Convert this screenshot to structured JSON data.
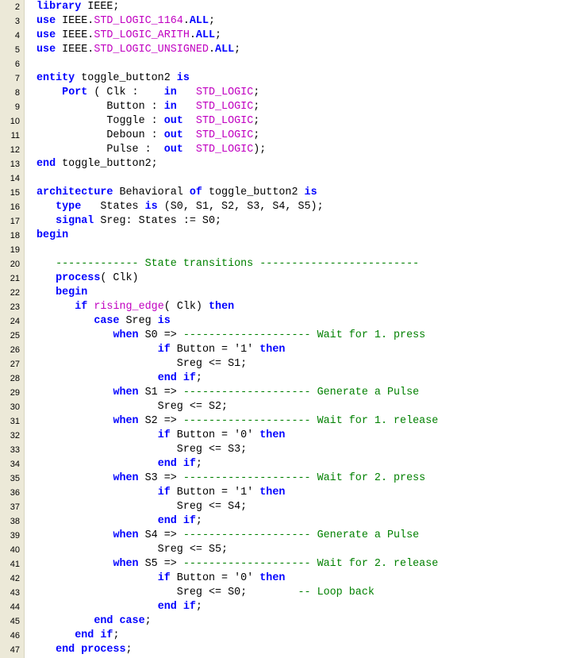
{
  "editor": {
    "lines": [
      {
        "n": "2",
        "t": [
          [
            "kw",
            "library"
          ],
          [
            "pl",
            " IEEE;"
          ]
        ]
      },
      {
        "n": "3",
        "t": [
          [
            "kw",
            "use"
          ],
          [
            "pl",
            " IEEE."
          ],
          [
            "ty",
            "STD_LOGIC_1164"
          ],
          [
            "pl",
            "."
          ],
          [
            "kw",
            "ALL"
          ],
          [
            "pl",
            ";"
          ]
        ]
      },
      {
        "n": "4",
        "t": [
          [
            "kw",
            "use"
          ],
          [
            "pl",
            " IEEE."
          ],
          [
            "ty",
            "STD_LOGIC_ARITH"
          ],
          [
            "pl",
            "."
          ],
          [
            "kw",
            "ALL"
          ],
          [
            "pl",
            ";"
          ]
        ]
      },
      {
        "n": "5",
        "t": [
          [
            "kw",
            "use"
          ],
          [
            "pl",
            " IEEE."
          ],
          [
            "ty",
            "STD_LOGIC_UNSIGNED"
          ],
          [
            "pl",
            "."
          ],
          [
            "kw",
            "ALL"
          ],
          [
            "pl",
            ";"
          ]
        ]
      },
      {
        "n": "6",
        "t": []
      },
      {
        "n": "7",
        "t": [
          [
            "kw",
            "entity"
          ],
          [
            "pl",
            " toggle_button2 "
          ],
          [
            "kw",
            "is"
          ]
        ]
      },
      {
        "n": "8",
        "t": [
          [
            "pl",
            "    "
          ],
          [
            "kw",
            "Port"
          ],
          [
            "pl",
            " ( Clk :    "
          ],
          [
            "kw",
            "in"
          ],
          [
            "pl",
            "   "
          ],
          [
            "ty",
            "STD_LOGIC"
          ],
          [
            "pl",
            ";"
          ]
        ]
      },
      {
        "n": "9",
        "t": [
          [
            "pl",
            "           Button : "
          ],
          [
            "kw",
            "in"
          ],
          [
            "pl",
            "   "
          ],
          [
            "ty",
            "STD_LOGIC"
          ],
          [
            "pl",
            ";"
          ]
        ]
      },
      {
        "n": "10",
        "t": [
          [
            "pl",
            "           Toggle : "
          ],
          [
            "kw",
            "out"
          ],
          [
            "pl",
            "  "
          ],
          [
            "ty",
            "STD_LOGIC"
          ],
          [
            "pl",
            ";"
          ]
        ]
      },
      {
        "n": "11",
        "t": [
          [
            "pl",
            "           Deboun : "
          ],
          [
            "kw",
            "out"
          ],
          [
            "pl",
            "  "
          ],
          [
            "ty",
            "STD_LOGIC"
          ],
          [
            "pl",
            ";"
          ]
        ]
      },
      {
        "n": "12",
        "t": [
          [
            "pl",
            "           Pulse :  "
          ],
          [
            "kw",
            "out"
          ],
          [
            "pl",
            "  "
          ],
          [
            "ty",
            "STD_LOGIC"
          ],
          [
            "pl",
            ");"
          ]
        ]
      },
      {
        "n": "13",
        "t": [
          [
            "kw",
            "end"
          ],
          [
            "pl",
            " toggle_button2;"
          ]
        ]
      },
      {
        "n": "14",
        "t": []
      },
      {
        "n": "15",
        "t": [
          [
            "kw",
            "architecture"
          ],
          [
            "pl",
            " Behavioral "
          ],
          [
            "kw",
            "of"
          ],
          [
            "pl",
            " toggle_button2 "
          ],
          [
            "kw",
            "is"
          ]
        ]
      },
      {
        "n": "16",
        "t": [
          [
            "pl",
            "   "
          ],
          [
            "kw",
            "type"
          ],
          [
            "pl",
            "   States "
          ],
          [
            "kw",
            "is"
          ],
          [
            "pl",
            " (S0, S1, S2, S3, S4, S5);"
          ]
        ]
      },
      {
        "n": "17",
        "t": [
          [
            "pl",
            "   "
          ],
          [
            "kw",
            "signal"
          ],
          [
            "pl",
            " Sreg: States := S0;"
          ]
        ]
      },
      {
        "n": "18",
        "t": [
          [
            "kw",
            "begin"
          ]
        ]
      },
      {
        "n": "19",
        "t": []
      },
      {
        "n": "20",
        "t": [
          [
            "pl",
            "   "
          ],
          [
            "cm",
            "------------- State transitions -------------------------"
          ]
        ]
      },
      {
        "n": "21",
        "t": [
          [
            "pl",
            "   "
          ],
          [
            "kw",
            "process"
          ],
          [
            "pl",
            "( Clk)"
          ]
        ]
      },
      {
        "n": "22",
        "t": [
          [
            "pl",
            "   "
          ],
          [
            "kw",
            "begin"
          ]
        ]
      },
      {
        "n": "23",
        "t": [
          [
            "pl",
            "      "
          ],
          [
            "kw",
            "if"
          ],
          [
            "pl",
            " "
          ],
          [
            "fn",
            "rising_edge"
          ],
          [
            "pl",
            "( Clk) "
          ],
          [
            "kw",
            "then"
          ]
        ]
      },
      {
        "n": "24",
        "t": [
          [
            "pl",
            "         "
          ],
          [
            "kw",
            "case"
          ],
          [
            "pl",
            " Sreg "
          ],
          [
            "kw",
            "is"
          ]
        ]
      },
      {
        "n": "25",
        "t": [
          [
            "pl",
            "            "
          ],
          [
            "kw",
            "when"
          ],
          [
            "pl",
            " S0 => "
          ],
          [
            "cm",
            "-------------------- Wait for 1. press"
          ]
        ]
      },
      {
        "n": "26",
        "t": [
          [
            "pl",
            "                   "
          ],
          [
            "kw",
            "if"
          ],
          [
            "pl",
            " Button = '1' "
          ],
          [
            "kw",
            "then"
          ]
        ]
      },
      {
        "n": "27",
        "t": [
          [
            "pl",
            "                      Sreg <= S1;"
          ]
        ]
      },
      {
        "n": "28",
        "t": [
          [
            "pl",
            "                   "
          ],
          [
            "kw",
            "end if"
          ],
          [
            "pl",
            ";"
          ]
        ]
      },
      {
        "n": "29",
        "t": [
          [
            "pl",
            "            "
          ],
          [
            "kw",
            "when"
          ],
          [
            "pl",
            " S1 => "
          ],
          [
            "cm",
            "-------------------- Generate a Pulse"
          ]
        ]
      },
      {
        "n": "30",
        "t": [
          [
            "pl",
            "                   Sreg <= S2;"
          ]
        ]
      },
      {
        "n": "31",
        "t": [
          [
            "pl",
            "            "
          ],
          [
            "kw",
            "when"
          ],
          [
            "pl",
            " S2 => "
          ],
          [
            "cm",
            "-------------------- Wait for 1. release"
          ]
        ]
      },
      {
        "n": "32",
        "t": [
          [
            "pl",
            "                   "
          ],
          [
            "kw",
            "if"
          ],
          [
            "pl",
            " Button = '0' "
          ],
          [
            "kw",
            "then"
          ]
        ]
      },
      {
        "n": "33",
        "t": [
          [
            "pl",
            "                      Sreg <= S3;"
          ]
        ]
      },
      {
        "n": "34",
        "t": [
          [
            "pl",
            "                   "
          ],
          [
            "kw",
            "end if"
          ],
          [
            "pl",
            ";"
          ]
        ]
      },
      {
        "n": "35",
        "t": [
          [
            "pl",
            "            "
          ],
          [
            "kw",
            "when"
          ],
          [
            "pl",
            " S3 => "
          ],
          [
            "cm",
            "-------------------- Wait for 2. press"
          ]
        ]
      },
      {
        "n": "36",
        "t": [
          [
            "pl",
            "                   "
          ],
          [
            "kw",
            "if"
          ],
          [
            "pl",
            " Button = '1' "
          ],
          [
            "kw",
            "then"
          ]
        ]
      },
      {
        "n": "37",
        "t": [
          [
            "pl",
            "                      Sreg <= S4;"
          ]
        ]
      },
      {
        "n": "38",
        "t": [
          [
            "pl",
            "                   "
          ],
          [
            "kw",
            "end if"
          ],
          [
            "pl",
            ";"
          ]
        ]
      },
      {
        "n": "39",
        "t": [
          [
            "pl",
            "            "
          ],
          [
            "kw",
            "when"
          ],
          [
            "pl",
            " S4 => "
          ],
          [
            "cm",
            "-------------------- Generate a Pulse"
          ]
        ]
      },
      {
        "n": "40",
        "t": [
          [
            "pl",
            "                   Sreg <= S5;"
          ]
        ]
      },
      {
        "n": "41",
        "t": [
          [
            "pl",
            "            "
          ],
          [
            "kw",
            "when"
          ],
          [
            "pl",
            " S5 => "
          ],
          [
            "cm",
            "-------------------- Wait for 2. release"
          ]
        ]
      },
      {
        "n": "42",
        "t": [
          [
            "pl",
            "                   "
          ],
          [
            "kw",
            "if"
          ],
          [
            "pl",
            " Button = '0' "
          ],
          [
            "kw",
            "then"
          ]
        ]
      },
      {
        "n": "43",
        "t": [
          [
            "pl",
            "                      Sreg <= S0;        "
          ],
          [
            "cm",
            "-- Loop back"
          ]
        ]
      },
      {
        "n": "44",
        "t": [
          [
            "pl",
            "                   "
          ],
          [
            "kw",
            "end if"
          ],
          [
            "pl",
            ";"
          ]
        ]
      },
      {
        "n": "45",
        "t": [
          [
            "pl",
            "         "
          ],
          [
            "kw",
            "end case"
          ],
          [
            "pl",
            ";"
          ]
        ]
      },
      {
        "n": "46",
        "t": [
          [
            "pl",
            "      "
          ],
          [
            "kw",
            "end if"
          ],
          [
            "pl",
            ";"
          ]
        ]
      },
      {
        "n": "47",
        "t": [
          [
            "pl",
            "   "
          ],
          [
            "kw",
            "end process"
          ],
          [
            "pl",
            ";"
          ]
        ]
      }
    ]
  }
}
